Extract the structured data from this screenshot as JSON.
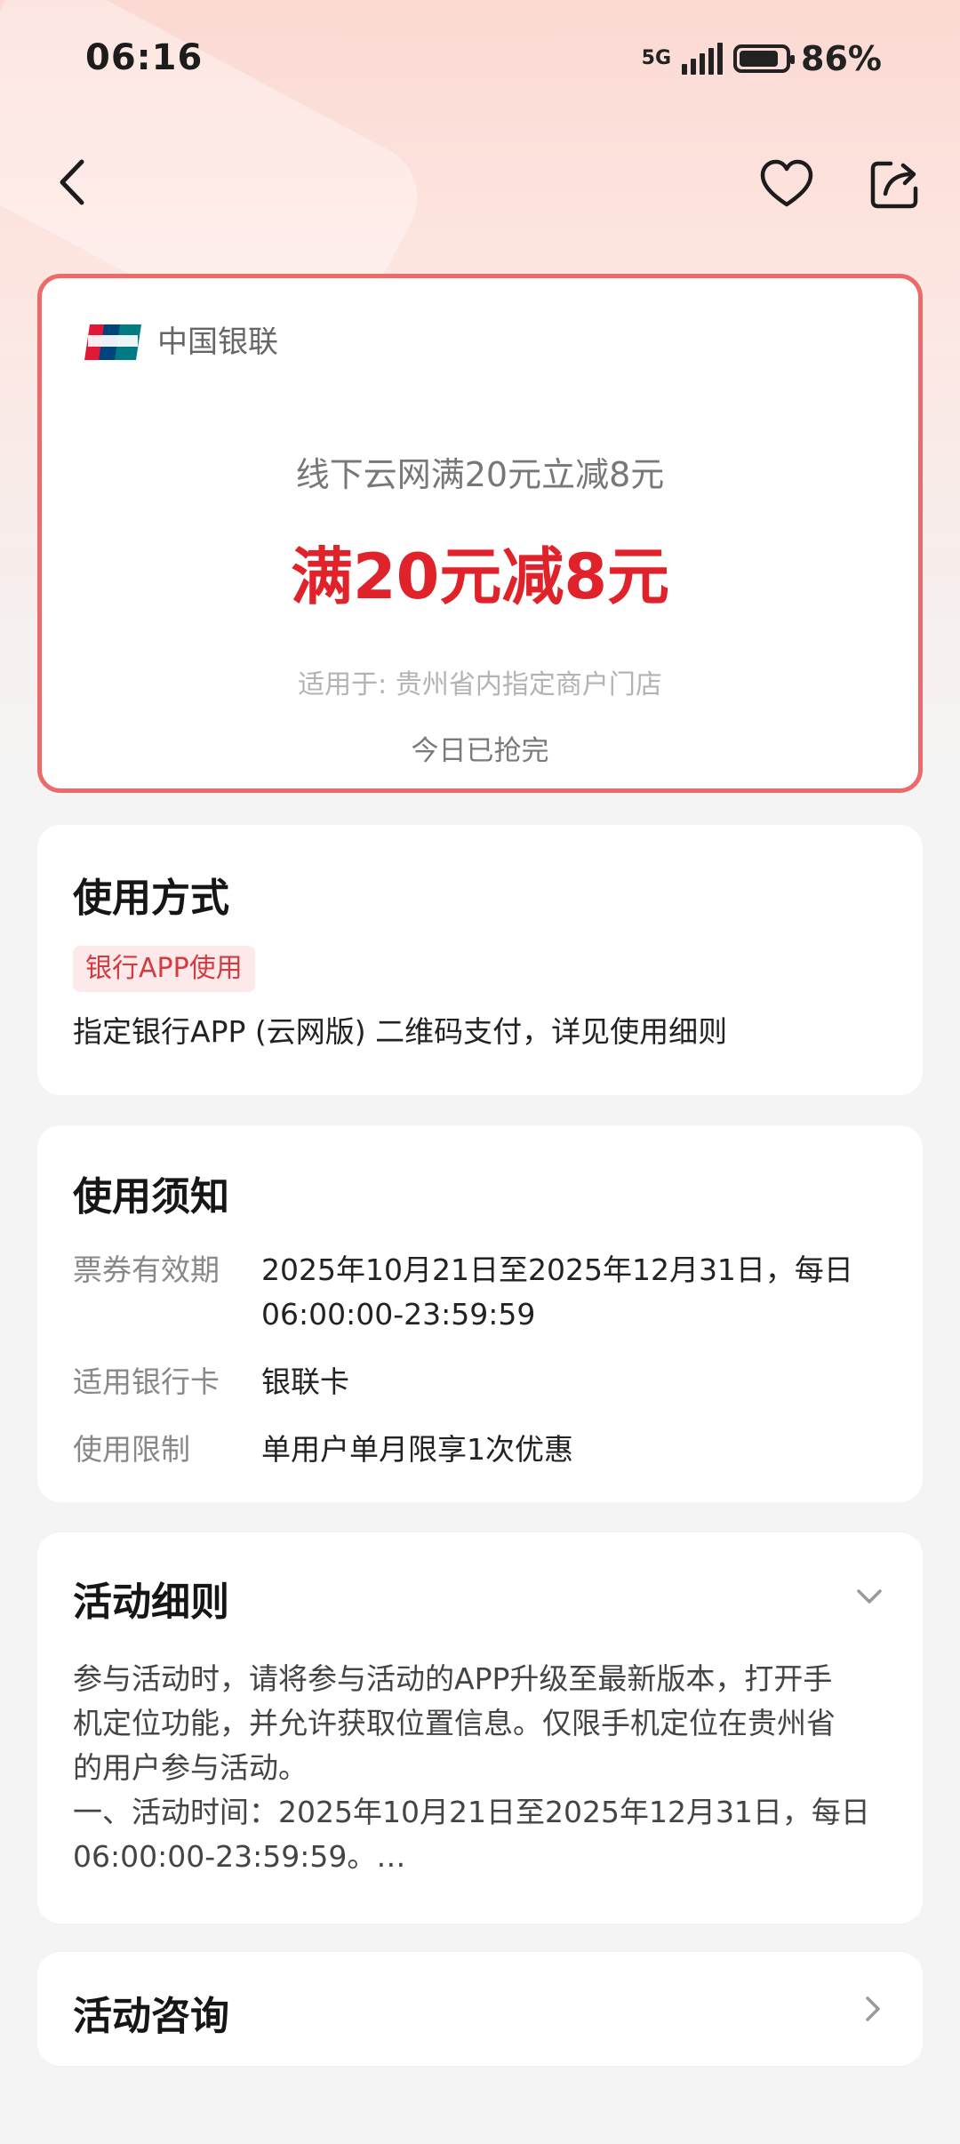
{
  "status_bar": {
    "time": "06:16",
    "network": "5G",
    "battery_percent": "86%",
    "battery_level": 0.86
  },
  "nav": {
    "back_icon": "chevron-left-icon",
    "favorite_icon": "heart-icon",
    "share_icon": "share-icon"
  },
  "coupon": {
    "bank_name": "中国银联",
    "title": "线下云网满20元立减8元",
    "amount": "满20元减8元",
    "scope": "适用于: 贵州省内指定商户门店",
    "status": "今日已抢完",
    "accent_color": "#e0232a",
    "border_color": "#ec6a6a"
  },
  "usage": {
    "title": "使用方式",
    "tag": "银行APP使用",
    "description": "指定银行APP (云网版) 二维码支付，详见使用细则"
  },
  "notice": {
    "title": "使用须知",
    "rows": [
      {
        "label": "票券有效期",
        "value_line1": "2025年10月21日至2025年12月31日，每日",
        "value_line2": "06:00:00-23:59:59"
      },
      {
        "label": "适用银行卡",
        "value_line1": "银联卡"
      },
      {
        "label": "使用限制",
        "value_line1": "单用户单月限享1次优惠"
      }
    ]
  },
  "rules": {
    "title": "活动细则",
    "lines": [
      "参与活动时，请将参与活动的APP升级至最新版本，打开手",
      "机定位功能，并允许获取位置信息。仅限手机定位在贵州省",
      "的用户参与活动。",
      "一、活动时间：2025年10月21日至2025年12月31日，每日",
      "06:00:00-23:59:59。…"
    ]
  },
  "consult": {
    "title": "活动咨询"
  }
}
